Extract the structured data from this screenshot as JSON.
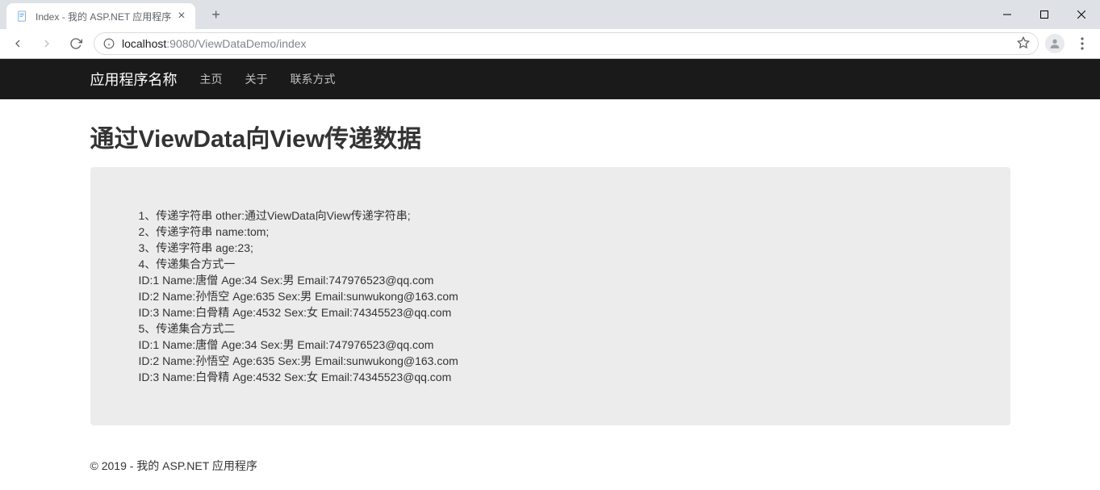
{
  "browser": {
    "tab_title": "Index - 我的 ASP.NET 应用程序",
    "url_prefix": "localhost",
    "url_port_path": ":9080/ViewDataDemo/index"
  },
  "navbar": {
    "brand": "应用程序名称",
    "links": [
      "主页",
      "关于",
      "联系方式"
    ]
  },
  "page": {
    "title": "通过ViewData向View传递数据",
    "lines": [
      "1、传递字符串 other:通过ViewData向View传递字符串;",
      "2、传递字符串 name:tom;",
      "3、传递字符串 age:23;",
      "4、传递集合方式一",
      "ID:1  Name:唐僧  Age:34  Sex:男  Email:747976523@qq.com",
      "ID:2  Name:孙悟空  Age:635  Sex:男  Email:sunwukong@163.com",
      "ID:3  Name:白骨精  Age:4532  Sex:女  Email:74345523@qq.com",
      "5、传递集合方式二",
      "ID:1  Name:唐僧  Age:34  Sex:男  Email:747976523@qq.com",
      "ID:2  Name:孙悟空  Age:635  Sex:男  Email:sunwukong@163.com",
      "ID:3  Name:白骨精  Age:4532  Sex:女  Email:74345523@qq.com"
    ]
  },
  "footer": "© 2019 - 我的 ASP.NET 应用程序"
}
